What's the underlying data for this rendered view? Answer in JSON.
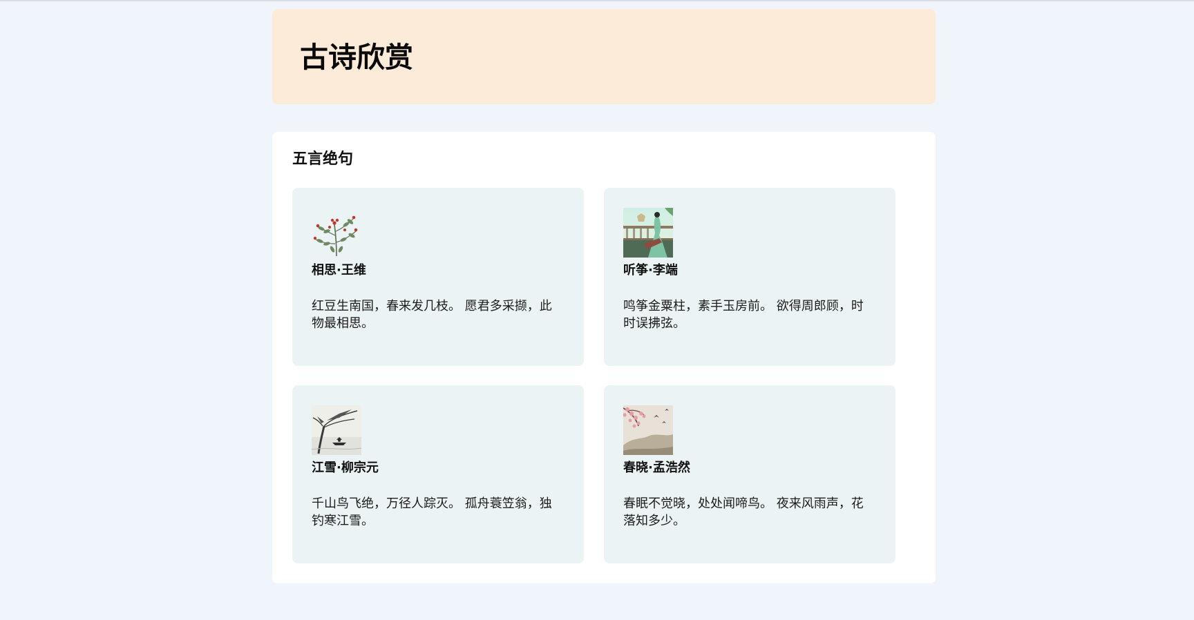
{
  "page": {
    "title": "古诗欣赏"
  },
  "section": {
    "title": "五言绝句",
    "poems": [
      {
        "title": "相思·王维",
        "text": "红豆生南国，春来发几枝。 愿君多采撷，此物最相思。",
        "image_icon": "red-bean-branch-icon"
      },
      {
        "title": "听筝·李端",
        "text": "鸣筝金粟柱，素手玉房前。 欲得周郎顾，时时误拂弦。",
        "image_icon": "zither-lady-painting-icon"
      },
      {
        "title": "江雪·柳宗元",
        "text": "千山鸟飞绝，万径人踪灭。 孤舟蓑笠翁，独钓寒江雪。",
        "image_icon": "snowy-river-boat-icon"
      },
      {
        "title": "春晓·孟浩然",
        "text": "春眠不觉晓，处处闻啼鸟。 夜来风雨声，花落知多少。",
        "image_icon": "spring-blossom-birds-icon"
      }
    ]
  },
  "colors": {
    "page_bg": "#eff5fb",
    "header_bg": "#fbebd8",
    "section_bg": "#ffffff",
    "card_bg": "#ebf3f5"
  }
}
